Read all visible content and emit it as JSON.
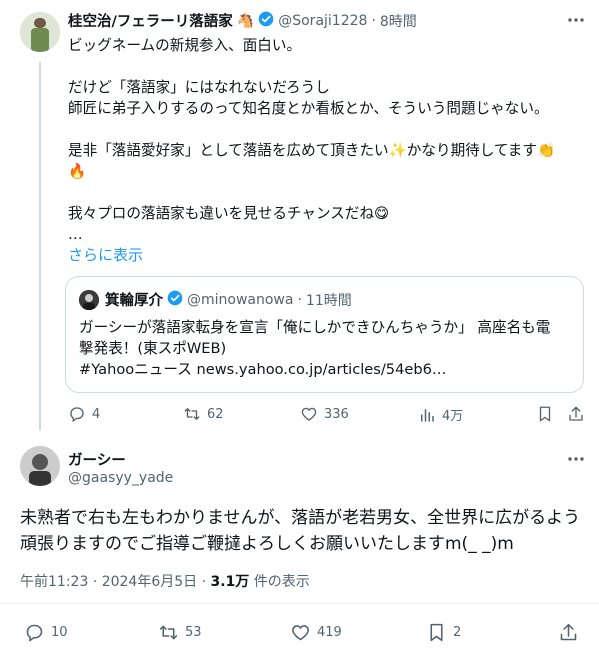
{
  "tweet1": {
    "display_name": "桂空治/フェラーリ落語家",
    "handle": "@Soraji1228",
    "sep": "·",
    "time": "8時間",
    "lines": [
      "ビッグネームの新規参入、面白い。",
      "だけど「落語家」にはなれないだろうし",
      "師匠に弟子入りするのって知名度とか看板とか、そういう問題じゃない。",
      "是非「落語愛好家」として落語を広めて頂きたい✨かなり期待してます👏",
      "🔥",
      "我々プロの落語家も違いを見せるチャンスだね😋",
      "…"
    ],
    "show_more": "さらに表示",
    "quote": {
      "display_name": "箕輪厚介",
      "handle": "@minowanowa",
      "sep": "·",
      "time": "11時間",
      "line1": "ガーシーが落語家転身を宣言「俺にしかできひんちゃうか」 高座名も電",
      "line2": "撃発表！(東スポWEB)",
      "line3": "#Yahooニュース news.yahoo.co.jp/articles/54eb6…"
    },
    "stats": {
      "replies": "4",
      "retweets": "62",
      "likes": "336",
      "views": "4万"
    }
  },
  "tweet2": {
    "display_name": "ガーシー",
    "handle": "@gaasyy_yade",
    "line1": "未熟者で右も左もわかりませんが、落語が老若男女、全世界に広がるよう",
    "line2": "頑張りますのでご指導ご鞭撻よろしくお願いいたしますm(_ _)m",
    "meta_time": "午前11:23 · 2024年6月5日 · ",
    "meta_views": "3.1万",
    "meta_views_suffix": " 件の表示",
    "stats": {
      "replies": "10",
      "retweets": "53",
      "likes": "419",
      "bookmarks": "2"
    }
  },
  "colors": {
    "accent": "#1d9bf0",
    "muted": "#536471",
    "border": "#cfd9de"
  }
}
